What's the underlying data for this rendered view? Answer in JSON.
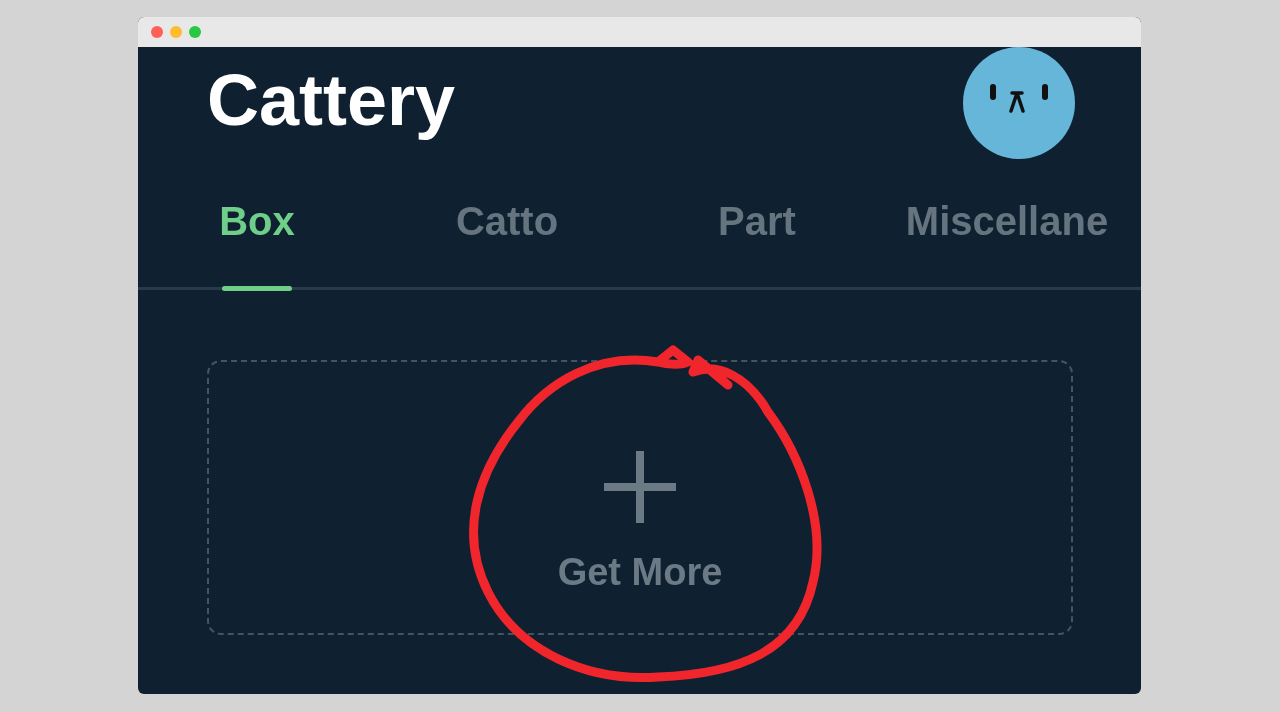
{
  "app": {
    "title": "Cattery"
  },
  "tabs": [
    {
      "label": "Box",
      "selected": true
    },
    {
      "label": "Catto",
      "selected": false
    },
    {
      "label": "Part",
      "selected": false
    },
    {
      "label": "Miscellane",
      "selected": false
    }
  ],
  "add_card": {
    "label": "Get More"
  }
}
